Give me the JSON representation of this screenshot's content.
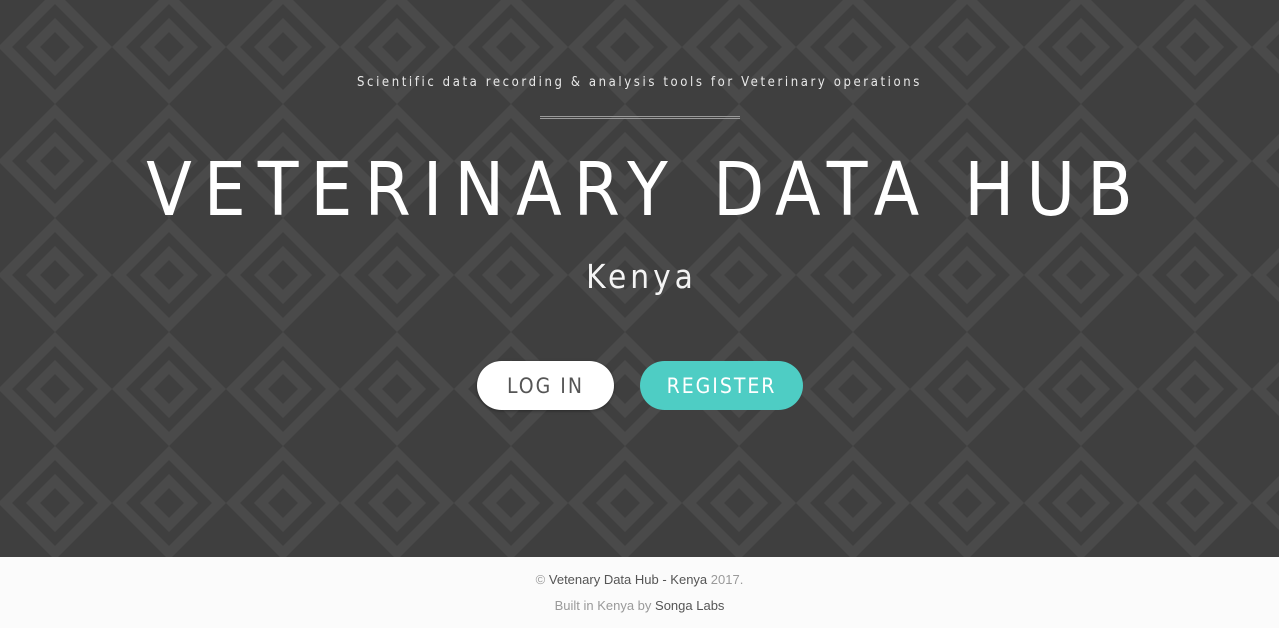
{
  "hero": {
    "tagline": "Scientific data recording & analysis tools for Veterinary operations",
    "title": "VETERINARY DATA HUB",
    "subtitle": "Kenya",
    "login_label": "LOG IN",
    "register_label": "REGISTER",
    "background_color": "#3f3f3f",
    "register_color": "#4ecdc4"
  },
  "footer": {
    "copyright_symbol": "©",
    "site_link": "Vetenary Data Hub - Kenya",
    "year": "2017.",
    "built_in": "Built in Kenya by",
    "builder_link": "Songa Labs"
  }
}
